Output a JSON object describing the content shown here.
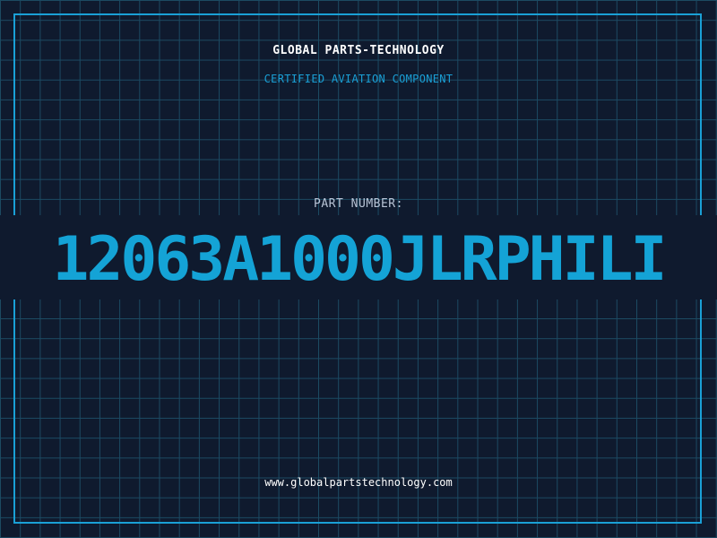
{
  "header": {
    "company": "GLOBAL PARTS-TECHNOLOGY",
    "subtitle": "CERTIFIED AVIATION COMPONENT"
  },
  "part": {
    "label": "PART NUMBER:",
    "number": "12063A1000JLRPHILI"
  },
  "footer": {
    "url": "www.globalpartstechnology.com"
  },
  "colors": {
    "background": "#0f1a2e",
    "grid": "#1c4a63",
    "accent": "#1aa0d6",
    "text": "#ffffff"
  }
}
